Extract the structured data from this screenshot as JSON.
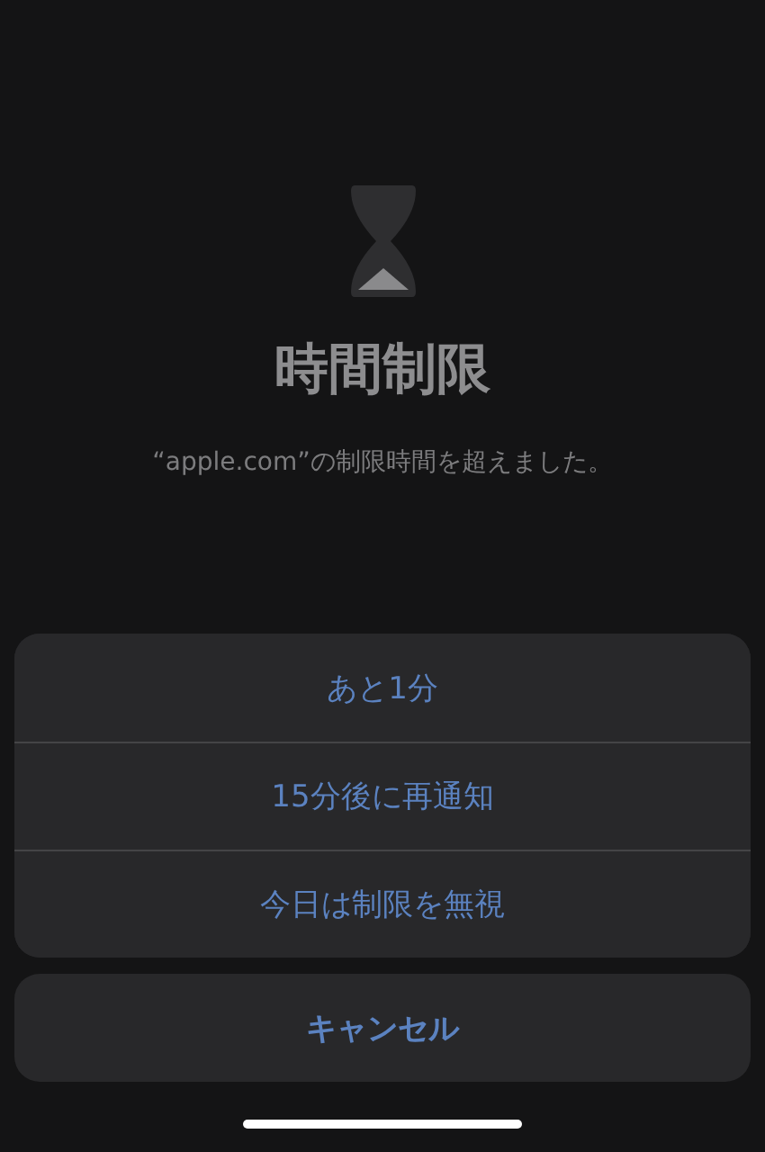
{
  "title": "時間制限",
  "message": "“apple.com”の制限時間を超えました。",
  "actions": [
    {
      "label": "あと1分"
    },
    {
      "label": "15分後に再通知"
    },
    {
      "label": "今日は制限を無視"
    }
  ],
  "cancel": {
    "label": "キャンセル"
  }
}
